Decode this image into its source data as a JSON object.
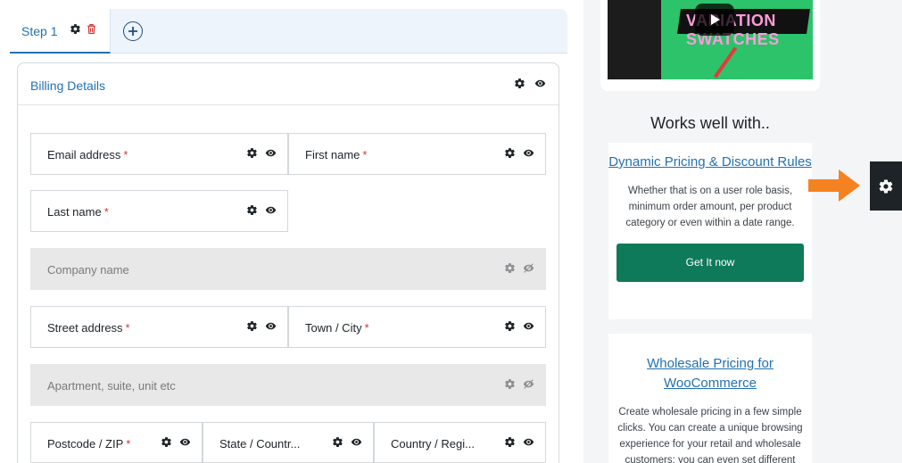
{
  "tabs": {
    "step_label": "Step 1"
  },
  "section": {
    "title": "Billing Details"
  },
  "fields": [
    {
      "label": "Email address",
      "required": "*"
    },
    {
      "label": "First name",
      "required": "*"
    },
    {
      "label": "Last name",
      "required": "*"
    },
    {
      "label": "Company name",
      "required": ""
    },
    {
      "label": "Street address",
      "required": "*"
    },
    {
      "label": "Town / City",
      "required": "*"
    },
    {
      "label": "Apartment, suite, unit etc",
      "required": ""
    },
    {
      "label": "Postcode / ZIP",
      "required": "*"
    },
    {
      "label": "State / Countr...",
      "required": ""
    },
    {
      "label": "Country / Regi...",
      "required": ""
    }
  ],
  "video": {
    "banner_text": "VARIATION SWATCHES"
  },
  "sidebar": {
    "works_title": "Works well with..",
    "promos": [
      {
        "link": "Dynamic Pricing & Discount Rules",
        "desc": "Whether that is on a user role basis, minimum order amount, per product category or even within a date range.",
        "button": "Get It now"
      },
      {
        "link": "Wholesale Pricing for WooCommerce",
        "desc": "Create wholesale pricing in a few simple clicks. You can create a unique browsing experience for your retail and wholesale customers; you can even set different"
      }
    ]
  },
  "colors": {
    "accent": "#2271b1",
    "required": "#d63638",
    "button": "#0f7a5a",
    "arrow": "#f58220"
  }
}
